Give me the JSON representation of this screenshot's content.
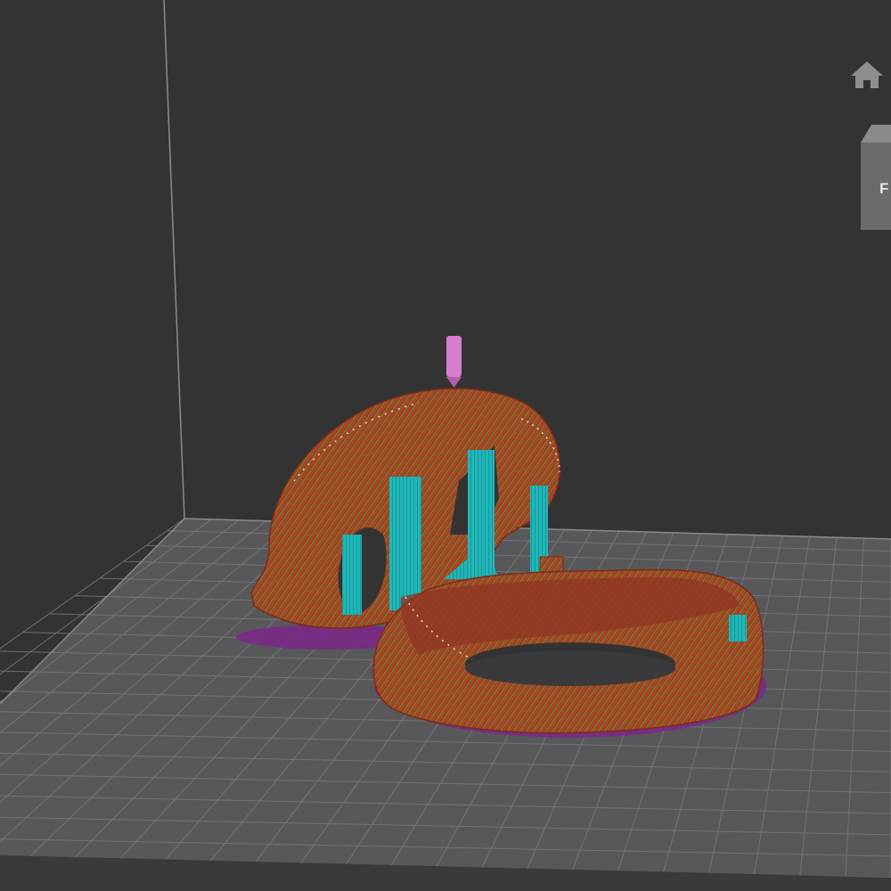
{
  "viewport": {
    "background_color": "#333334",
    "bed_color": "#5a5a5c",
    "grid_line_color": "#747477",
    "axis_line_color": "#8a8a8c"
  },
  "navigation": {
    "home_icon": "home-icon",
    "view_cube_face_label": "F"
  },
  "preview": {
    "wall_color": "#a23a26",
    "infill_color": "#6b8a1e",
    "support_color": "#1fb6b8",
    "skirt_color": "#7a2a86",
    "nozzle_color": "#d67fd1"
  }
}
